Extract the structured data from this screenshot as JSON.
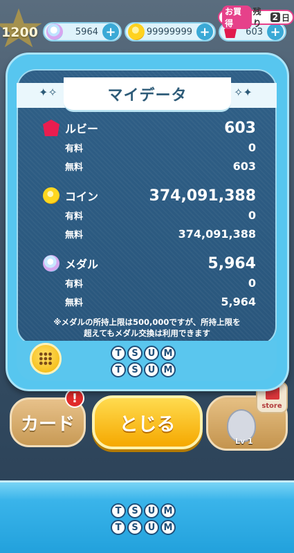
{
  "topbar": {
    "level": "1200",
    "medals": "5964",
    "coins": "99999999",
    "rubies": "603",
    "bonus_tag": "お買得",
    "bonus_remaining": "残り",
    "bonus_days": "2",
    "bonus_unit": "日",
    "plus": "+"
  },
  "modal": {
    "title": "マイデータ",
    "sections": [
      {
        "icon": "ruby-icon",
        "label": "ルビー",
        "total": "603",
        "paid_label": "有料",
        "paid": "0",
        "free_label": "無料",
        "free": "603"
      },
      {
        "icon": "coin-icon",
        "label": "コイン",
        "total": "374,091,388",
        "paid_label": "有料",
        "paid": "0",
        "free_label": "無料",
        "free": "374,091,388"
      },
      {
        "icon": "medal-icon",
        "label": "メダル",
        "total": "5,964",
        "paid_label": "有料",
        "paid": "0",
        "free_label": "無料",
        "free": "5,964"
      }
    ],
    "note_line1": "※メダルの所持上限は500,000ですが、所持上限を",
    "note_line2": "超えてもメダル交換は利用できます",
    "logo_row1": [
      "T",
      "S",
      "U",
      "M"
    ],
    "logo_row2": [
      "T",
      "S",
      "U",
      "M"
    ]
  },
  "buttons": {
    "close": "とじる",
    "card": "カード",
    "card_alert": "!",
    "store": "store",
    "char_level": "Lv 1"
  },
  "colors": {
    "accent_blue": "#3ab4ea",
    "button_yellow": "#f5a800",
    "panel_navy": "#29567c",
    "ruby": "#e11a4d"
  }
}
